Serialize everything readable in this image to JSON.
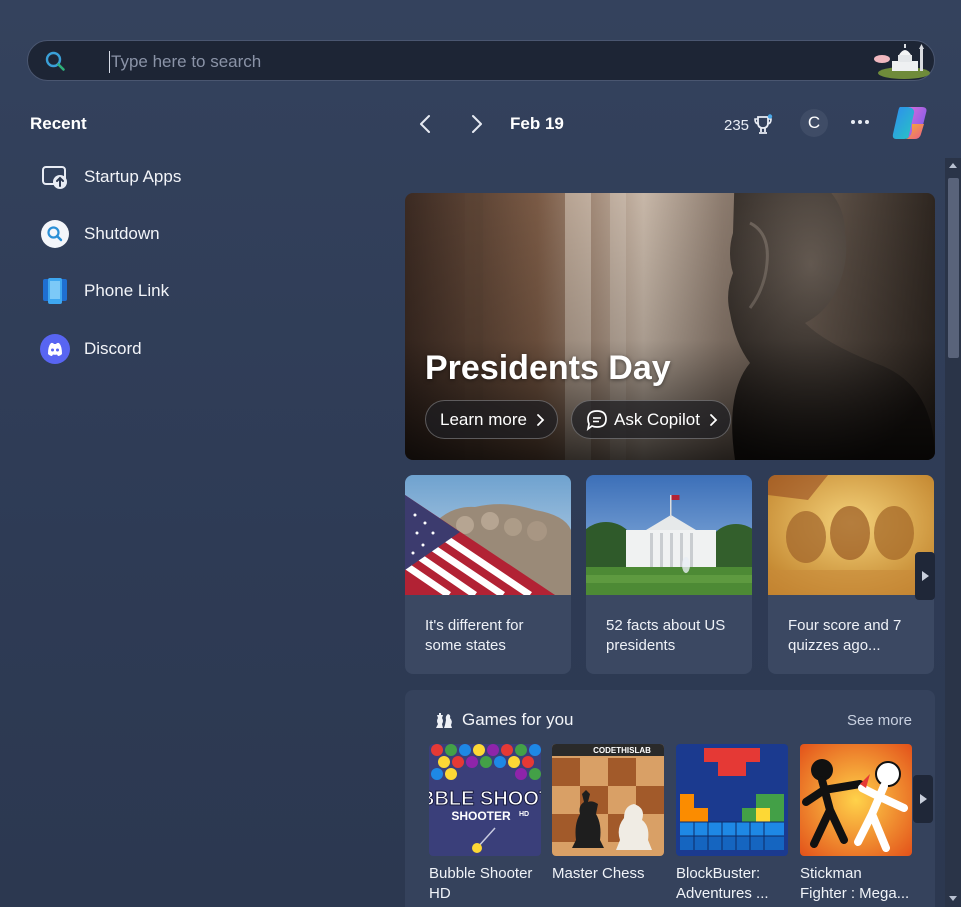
{
  "search": {
    "placeholder": "Type here to search"
  },
  "recent": {
    "title": "Recent",
    "items": [
      {
        "label": "Startup Apps",
        "icon": "startup-apps-icon"
      },
      {
        "label": "Shutdown",
        "icon": "search-circle-icon"
      },
      {
        "label": "Phone Link",
        "icon": "phone-link-icon"
      },
      {
        "label": "Discord",
        "icon": "discord-icon"
      }
    ]
  },
  "header": {
    "date": "Feb 19",
    "points": "235",
    "avatar_initial": "C"
  },
  "hero": {
    "title": "Presidents Day",
    "learn_more": "Learn more",
    "ask_copilot": "Ask Copilot"
  },
  "cards": [
    {
      "text": "It's different for some states"
    },
    {
      "text": "52 facts about US presidents"
    },
    {
      "text": "Four score and 7 quizzes ago..."
    }
  ],
  "games": {
    "title": "Games for you",
    "see_more": "See more",
    "items": [
      {
        "name": "Bubble Shooter HD",
        "thumb_text": "BUBBLE SHOOTER",
        "thumb_sub": "HD"
      },
      {
        "name": "Master Chess",
        "thumb_text": "CODETHISLAB"
      },
      {
        "name": "BlockBuster: Adventures ..."
      },
      {
        "name": "Stickman Fighter : Mega..."
      }
    ]
  },
  "colors": {
    "background": "#2c3850",
    "search_bg": "#1d2535",
    "card_bg": "#3b4862",
    "games_bg": "#35425c",
    "accent": "#4aa8e8"
  }
}
